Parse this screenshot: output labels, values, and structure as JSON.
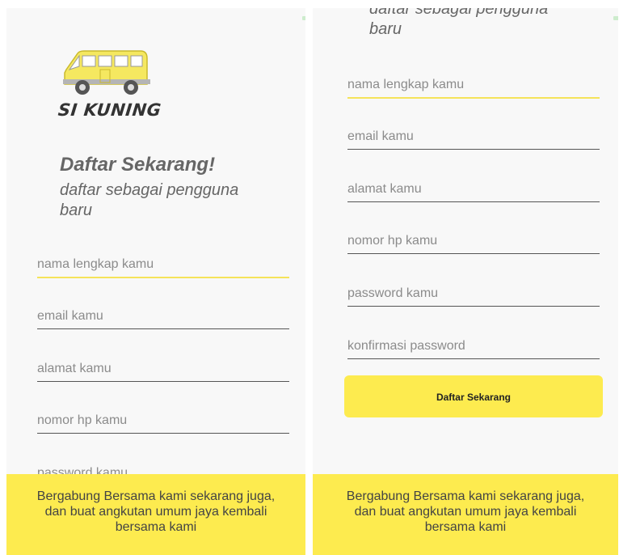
{
  "brand": {
    "logo_text": "SI KUNING",
    "van_color": "#f5e860"
  },
  "accent_color": "#fdeb4f",
  "register": {
    "heading": "Daftar Sekarang!",
    "subheading_line1": "daftar sebagai pengguna",
    "subheading_line2": "baru",
    "fields": {
      "name": "nama lengkap kamu",
      "email": "email kamu",
      "address": "alamat kamu",
      "phone": "nomor hp kamu",
      "password": "password kamu",
      "confirm_password": "konfirmasi password"
    },
    "submit_label": "Daftar Sekarang"
  },
  "footer": {
    "line1": "Bergabung Bersama kami sekarang juga,",
    "line2": "dan buat angkutan umum jaya kembali",
    "line3": "bersama kami"
  }
}
